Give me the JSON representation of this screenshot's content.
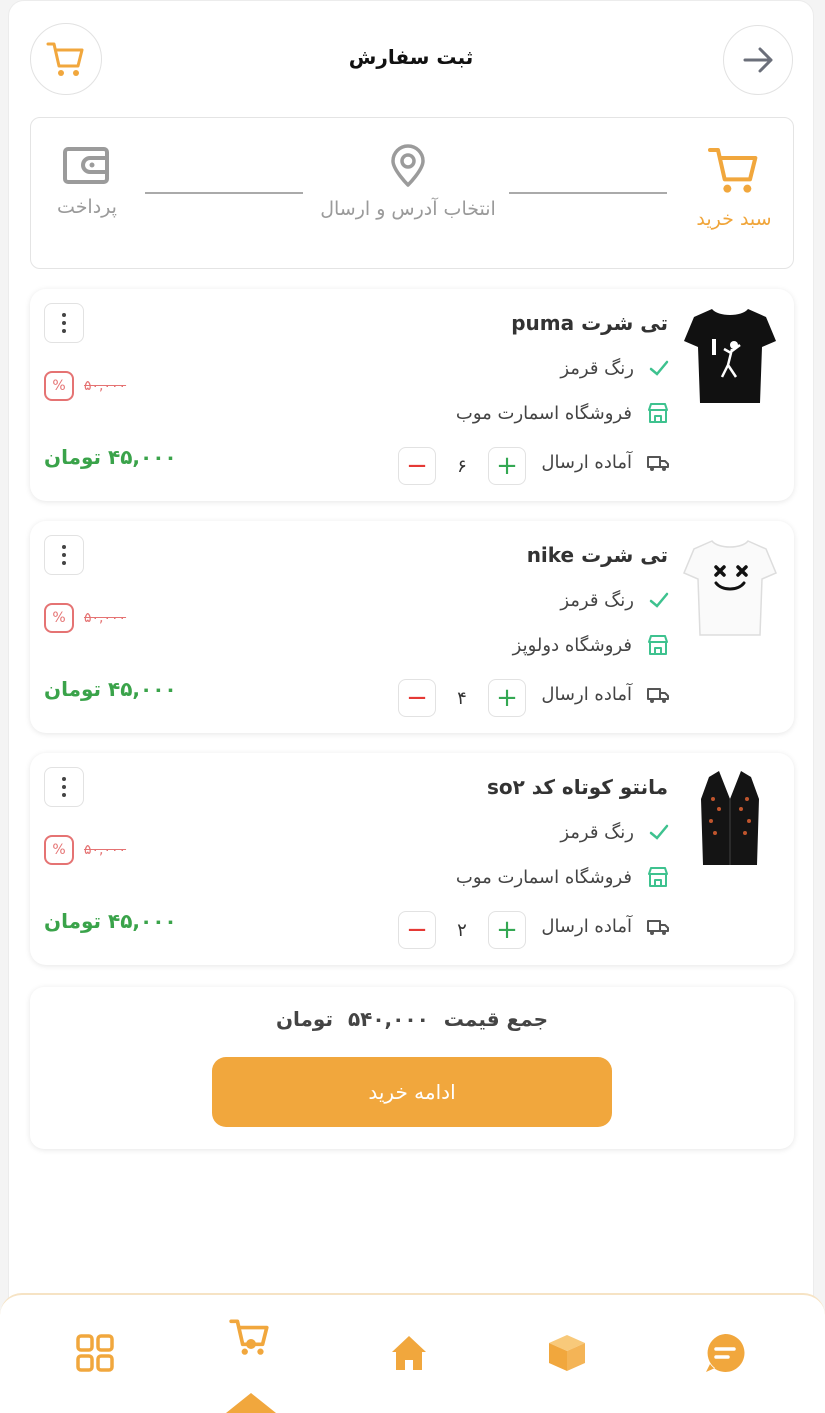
{
  "header": {
    "title": "ثبت سفارش"
  },
  "steps": [
    {
      "label": "سبد خرید",
      "state": "active",
      "icon": "cart-icon"
    },
    {
      "label": "انتخاب آدرس و ارسال",
      "state": "inactive",
      "icon": "location-pin-icon"
    },
    {
      "label": "پرداخت",
      "state": "inactive",
      "icon": "wallet-icon"
    }
  ],
  "products": [
    {
      "title": "تی شرت puma",
      "color": "رنگ قرمز",
      "shop": "فروشگاه اسمارت موب",
      "shipping": "آماده ارسال",
      "quantity": "۶",
      "old_price": "۵۰,۰۰۰",
      "price": "۴۵,۰۰۰ تومان",
      "discount_symbol": "%",
      "image": "black-tshirt"
    },
    {
      "title": "تی شرت nike",
      "color": "رنگ قرمز",
      "shop": "فروشگاه دولوپز",
      "shipping": "آماده ارسال",
      "quantity": "۴",
      "old_price": "۵۰,۰۰۰",
      "price": "۴۵,۰۰۰ تومان",
      "discount_symbol": "%",
      "image": "white-tshirt"
    },
    {
      "title": "مانتو کوتاه کد so۲",
      "color": "رنگ قرمز",
      "shop": "فروشگاه اسمارت موب",
      "shipping": "آماده ارسال",
      "quantity": "۲",
      "old_price": "۵۰,۰۰۰",
      "price": "۴۵,۰۰۰ تومان",
      "discount_symbol": "%",
      "image": "black-manteau"
    }
  ],
  "qty_controls": {
    "plus": "+",
    "minus": "−"
  },
  "total": {
    "label": "جمع قیمت",
    "amount": "۵۴۰,۰۰۰",
    "currency": "تومان"
  },
  "continue_button": "ادامه خرید",
  "bottom_nav": [
    {
      "name": "chat-icon"
    },
    {
      "name": "box-icon"
    },
    {
      "name": "home-icon"
    },
    {
      "name": "cart-icon",
      "active": true
    },
    {
      "name": "grid-icon"
    }
  ],
  "colors": {
    "accent": "#f1a73d",
    "price_green": "#3aa34a",
    "discount_red": "#e57373",
    "check_green": "#3ec28f"
  }
}
